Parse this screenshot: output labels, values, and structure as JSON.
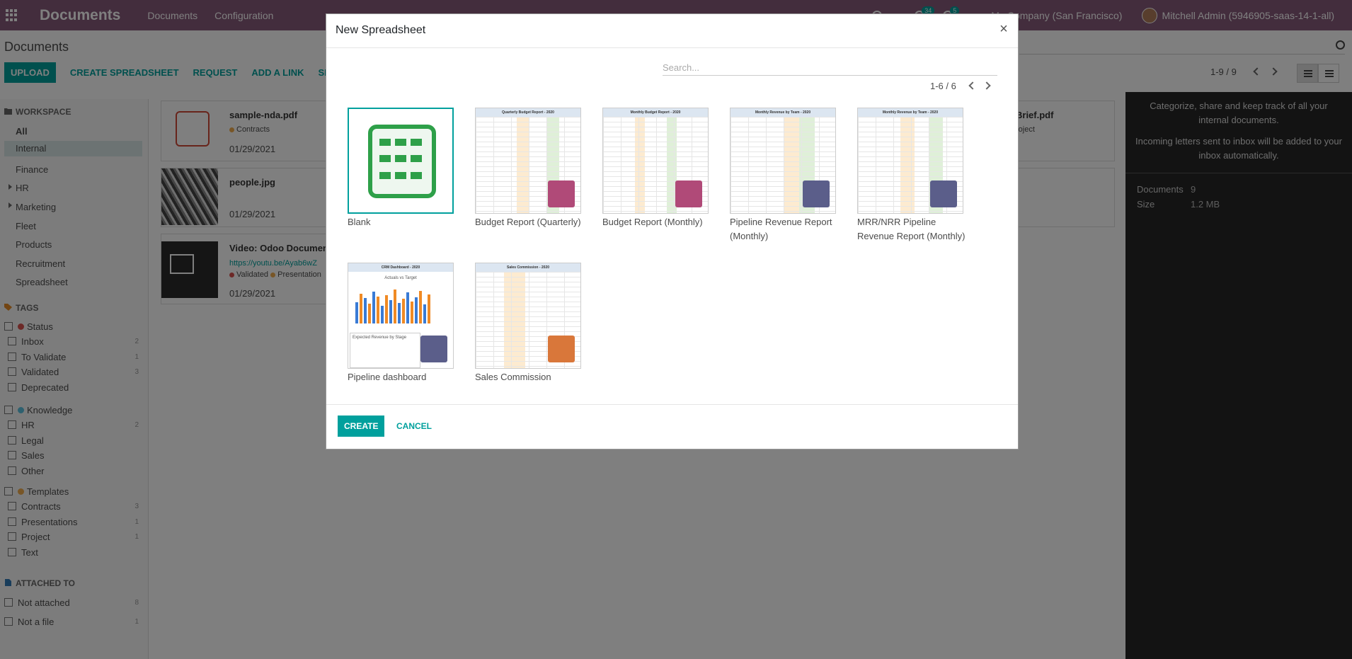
{
  "app": {
    "brand": "Documents",
    "menu": [
      "Documents",
      "Configuration"
    ],
    "activity_count": "34",
    "message_count": "5",
    "company": "My Company (San Francisco)",
    "user": "Mitchell Admin (5946905-saas-14-1-all)"
  },
  "control_panel": {
    "breadcrumb": "Documents",
    "buttons": {
      "upload": "UPLOAD",
      "create_spreadsheet": "CREATE SPREADSHEET",
      "request": "REQUEST",
      "add_link": "ADD A LINK",
      "share": "SHARE"
    },
    "pager": "1-9 / 9"
  },
  "sidebar": {
    "workspace_title": "WORKSPACE",
    "workspaces": [
      "All",
      "Internal",
      "Finance",
      "HR",
      "Marketing",
      "Fleet",
      "Products",
      "Recruitment",
      "Spreadsheet"
    ],
    "tags_title": "TAGS",
    "facets": [
      {
        "name": "Status",
        "color": "#d9534f",
        "tags": [
          {
            "name": "Inbox",
            "count": "2"
          },
          {
            "name": "To Validate",
            "count": "1"
          },
          {
            "name": "Validated",
            "count": "3"
          },
          {
            "name": "Deprecated",
            "count": ""
          }
        ]
      },
      {
        "name": "Knowledge",
        "color": "#5bc0de",
        "tags": [
          {
            "name": "HR",
            "count": "2"
          },
          {
            "name": "Legal",
            "count": ""
          },
          {
            "name": "Sales",
            "count": ""
          },
          {
            "name": "Other",
            "count": ""
          }
        ]
      },
      {
        "name": "Templates",
        "color": "#f0ad4e",
        "tags": [
          {
            "name": "Contracts",
            "count": "3"
          },
          {
            "name": "Presentations",
            "count": "1"
          },
          {
            "name": "Project",
            "count": "1"
          },
          {
            "name": "Text",
            "count": ""
          }
        ]
      }
    ],
    "attached_title": "ATTACHED TO",
    "attached": [
      {
        "name": "Not attached",
        "count": "8"
      },
      {
        "name": "Not a file",
        "count": "1"
      }
    ]
  },
  "documents": [
    {
      "title": "sample-nda.pdf",
      "tag": "Contracts",
      "date": "01/29/2021"
    },
    {
      "title": "people.jpg",
      "date": "01/29/2021"
    },
    {
      "title": "Video: Odoo Documents",
      "link": "https://youtu.be/Ayab6wZ",
      "tag1": "Validated",
      "tag2": "Presentation",
      "date": "01/29/2021"
    }
  ],
  "right_cards": [
    {
      "title": "Brief.pdf",
      "sub": "roject"
    }
  ],
  "info_panel": {
    "text1": "Categorize, share and keep track of all your internal documents.",
    "text2": "Incoming letters sent to inbox will be added to your inbox automatically.",
    "documents_label": "Documents",
    "documents_value": "9",
    "size_label": "Size",
    "size_value": "1.2 MB"
  },
  "modal": {
    "title": "New Spreadsheet",
    "close": "×",
    "search_placeholder": "Search...",
    "pager": "1-6 / 6",
    "templates": [
      {
        "name": "Blank"
      },
      {
        "name": "Budget Report (Quarterly)",
        "header": "Quarterly Budget Report - 2020"
      },
      {
        "name": "Budget Report (Monthly)",
        "header": "Monthly Budget Report - 2020"
      },
      {
        "name": "Pipeline Revenue Report (Monthly)",
        "header": "Monthly Revenue by Team - 2020"
      },
      {
        "name": "MRR/NRR Pipeline Revenue Report (Monthly)",
        "header": "Monthly Revenue by Team - 2020"
      },
      {
        "name": "Pipeline dashboard",
        "header": "CRM Dashboard - 2020",
        "chart_title": "Actuals vs Target",
        "sub_title": "Expected Revenue by Stage"
      },
      {
        "name": "Sales Commission",
        "header": "Sales Commission - 2020"
      }
    ],
    "create": "CREATE",
    "cancel": "CANCEL"
  },
  "colors": {
    "navbar": "#875a7b",
    "primary": "#00a09d",
    "spreadsheet_green": "#2ea049"
  }
}
